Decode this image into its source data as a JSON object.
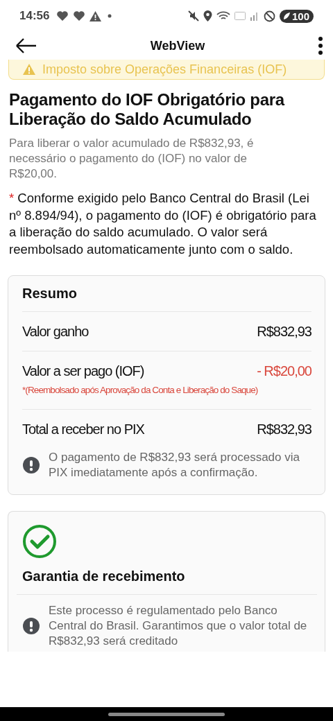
{
  "status_bar": {
    "time": "14:56",
    "battery": "100"
  },
  "app_bar": {
    "title": "WebView"
  },
  "banner": {
    "text": "Imposto sobre Operações Financeiras (IOF)"
  },
  "heading": "Pagamento do IOF Obrigatório para Liberação do Saldo Acumulado",
  "intro": "Para liberar o valor acumulado de R$832,93, é necessário o pagamento do (IOF) no valor de R$20,00.",
  "notice": {
    "mark": "*",
    "text": "Conforme exigido pelo Banco Central do Brasil (Lei nº 8.894/94), o pagamento do (IOF) é obrigatório para a liberação do saldo acumulado. O valor será reembolsado automaticamente junto com o saldo."
  },
  "summary": {
    "title": "Resumo",
    "rows": [
      {
        "label": "Valor ganho",
        "value": "R$832,93",
        "kind": "credit"
      },
      {
        "label": "Valor a ser pago (IOF)",
        "value": "- R$20,00",
        "kind": "deduction",
        "note": "*(Reembolsado após Aprovação da Conta e Liberação do Saque)"
      },
      {
        "label": "Total a receber no PIX",
        "value": "R$832,93",
        "kind": "credit"
      }
    ],
    "info": "O pagamento de R$832,93 será processado via PIX imediatamente após a confirmação."
  },
  "guarantee": {
    "title": "Garantia de recebimento",
    "info": "Este processo é regulamentado pelo Banco Central do Brasil. Garantimos que o valor total de R$832,93 será creditado"
  }
}
